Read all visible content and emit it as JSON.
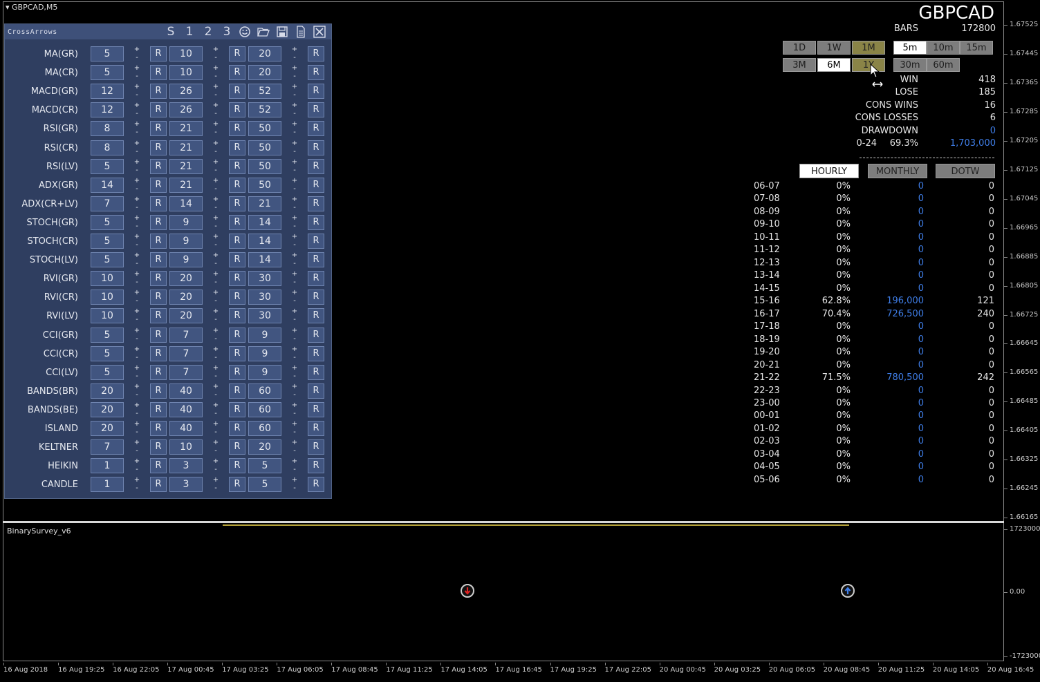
{
  "window": {
    "symbol_tab": "GBPCAD,M5",
    "pair": "GBPCAD"
  },
  "panel": {
    "title": "CrossArrows",
    "header_buttons": [
      "S",
      "1",
      "2",
      "3"
    ],
    "rows": [
      {
        "name": "MA(GR)",
        "v1": "5",
        "v2": "10",
        "v3": "20"
      },
      {
        "name": "MA(CR)",
        "v1": "5",
        "v2": "10",
        "v3": "20"
      },
      {
        "name": "MACD(GR)",
        "v1": "12",
        "v2": "26",
        "v3": "52"
      },
      {
        "name": "MACD(CR)",
        "v1": "12",
        "v2": "26",
        "v3": "52"
      },
      {
        "name": "RSI(GR)",
        "v1": "8",
        "v2": "21",
        "v3": "50"
      },
      {
        "name": "RSI(CR)",
        "v1": "8",
        "v2": "21",
        "v3": "50"
      },
      {
        "name": "RSI(LV)",
        "v1": "5",
        "v2": "21",
        "v3": "50"
      },
      {
        "name": "ADX(GR)",
        "v1": "14",
        "v2": "21",
        "v3": "50"
      },
      {
        "name": "ADX(CR+LV)",
        "v1": "7",
        "v2": "14",
        "v3": "21"
      },
      {
        "name": "STOCH(GR)",
        "v1": "5",
        "v2": "9",
        "v3": "14"
      },
      {
        "name": "STOCH(CR)",
        "v1": "5",
        "v2": "9",
        "v3": "14"
      },
      {
        "name": "STOCH(LV)",
        "v1": "5",
        "v2": "9",
        "v3": "14"
      },
      {
        "name": "RVI(GR)",
        "v1": "10",
        "v2": "20",
        "v3": "30"
      },
      {
        "name": "RVI(CR)",
        "v1": "10",
        "v2": "20",
        "v3": "30"
      },
      {
        "name": "RVI(LV)",
        "v1": "10",
        "v2": "20",
        "v3": "30"
      },
      {
        "name": "CCI(GR)",
        "v1": "5",
        "v2": "7",
        "v3": "9"
      },
      {
        "name": "CCI(CR)",
        "v1": "5",
        "v2": "7",
        "v3": "9"
      },
      {
        "name": "CCI(LV)",
        "v1": "5",
        "v2": "7",
        "v3": "9"
      },
      {
        "name": "BANDS(BR)",
        "v1": "20",
        "v2": "40",
        "v3": "60"
      },
      {
        "name": "BANDS(BE)",
        "v1": "20",
        "v2": "40",
        "v3": "60"
      },
      {
        "name": "ISLAND",
        "v1": "20",
        "v2": "40",
        "v3": "60"
      },
      {
        "name": "KELTNER",
        "v1": "7",
        "v2": "10",
        "v3": "20"
      },
      {
        "name": "HEIKIN",
        "v1": "1",
        "v2": "3",
        "v3": "5"
      },
      {
        "name": "CANDLE",
        "v1": "1",
        "v2": "3",
        "v3": "5"
      }
    ],
    "plus": "+",
    "minus": "-",
    "reset": "R"
  },
  "stats": {
    "bars_label": "BARS",
    "bars_value": "172800",
    "win_label": "WIN",
    "win_value": "418",
    "lose_label": "LOSE",
    "lose_value": "185",
    "cons_wins_label": "CONS WINS",
    "cons_wins_value": "16",
    "cons_losses_label": "CONS LOSSES",
    "cons_losses_value": "6",
    "drawdown_label": "DRAWDOWN",
    "drawdown_value": "0",
    "range_label": "0-24",
    "range_pct": "69.3%",
    "range_amount": "1,703,000"
  },
  "timeframes": {
    "period_row1": [
      "1D",
      "1W",
      "1M"
    ],
    "period_row2": [
      "3M",
      "6M",
      "1Y"
    ],
    "interval_row1": [
      "5m",
      "10m",
      "15m"
    ],
    "interval_row2": [
      "30m",
      "60m"
    ]
  },
  "tabs": [
    "HOURLY",
    "MONTHLY",
    "DOTW"
  ],
  "hourly": [
    [
      "06-07",
      "0%",
      "0",
      "0"
    ],
    [
      "07-08",
      "0%",
      "0",
      "0"
    ],
    [
      "08-09",
      "0%",
      "0",
      "0"
    ],
    [
      "09-10",
      "0%",
      "0",
      "0"
    ],
    [
      "10-11",
      "0%",
      "0",
      "0"
    ],
    [
      "11-12",
      "0%",
      "0",
      "0"
    ],
    [
      "12-13",
      "0%",
      "0",
      "0"
    ],
    [
      "13-14",
      "0%",
      "0",
      "0"
    ],
    [
      "14-15",
      "0%",
      "0",
      "0"
    ],
    [
      "15-16",
      "62.8%",
      "196,000",
      "121"
    ],
    [
      "16-17",
      "70.4%",
      "726,500",
      "240"
    ],
    [
      "17-18",
      "0%",
      "0",
      "0"
    ],
    [
      "18-19",
      "0%",
      "0",
      "0"
    ],
    [
      "19-20",
      "0%",
      "0",
      "0"
    ],
    [
      "20-21",
      "0%",
      "0",
      "0"
    ],
    [
      "21-22",
      "71.5%",
      "780,500",
      "242"
    ],
    [
      "22-23",
      "0%",
      "0",
      "0"
    ],
    [
      "23-00",
      "0%",
      "0",
      "0"
    ],
    [
      "00-01",
      "0%",
      "0",
      "0"
    ],
    [
      "01-02",
      "0%",
      "0",
      "0"
    ],
    [
      "02-03",
      "0%",
      "0",
      "0"
    ],
    [
      "03-04",
      "0%",
      "0",
      "0"
    ],
    [
      "04-05",
      "0%",
      "0",
      "0"
    ],
    [
      "05-06",
      "0%",
      "0",
      "0"
    ]
  ],
  "price_axis": [
    "1.67525",
    "1.67445",
    "1.67365",
    "1.67285",
    "1.67205",
    "1.67125",
    "1.67045",
    "1.66965",
    "1.66885",
    "1.66805",
    "1.66725",
    "1.66645",
    "1.66565",
    "1.66485",
    "1.66405",
    "1.66325",
    "1.66245",
    "1.66165"
  ],
  "sub_window": {
    "title": "BinarySurvey_v6",
    "axis": [
      "1723000",
      "0.00",
      "-1723000"
    ],
    "down_arrow_color": "#e02020",
    "up_arrow_color": "#3f7ee8"
  },
  "time_axis": [
    "16 Aug 2018",
    "16 Aug 19:25",
    "16 Aug 22:05",
    "17 Aug 00:45",
    "17 Aug 03:25",
    "17 Aug 06:05",
    "17 Aug 08:45",
    "17 Aug 11:25",
    "17 Aug 14:05",
    "17 Aug 16:45",
    "17 Aug 19:25",
    "17 Aug 22:05",
    "20 Aug 00:45",
    "20 Aug 03:25",
    "20 Aug 06:05",
    "20 Aug 08:45",
    "20 Aug 11:25",
    "20 Aug 14:05",
    "20 Aug 16:45"
  ]
}
